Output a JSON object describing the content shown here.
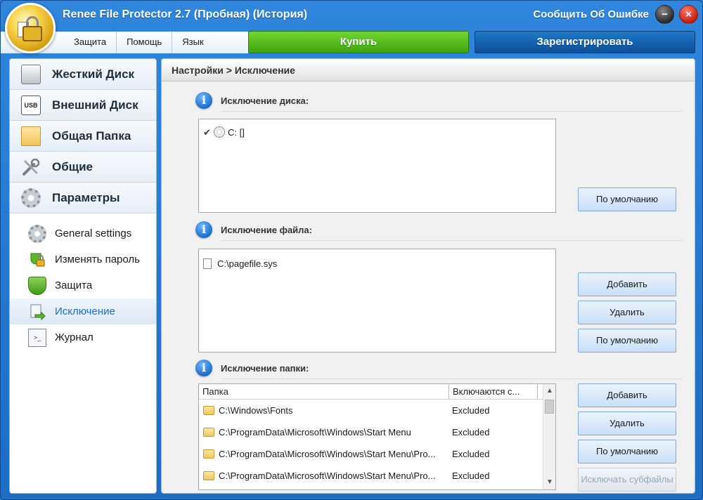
{
  "window": {
    "title": "Renee File Protector 2.7 (Пробная) (История)",
    "report_link": "Сообщить Об Ошибке",
    "minimize": "−",
    "close": "×"
  },
  "menu": {
    "items": [
      "Защита",
      "Помощь",
      "Язык"
    ],
    "buy": "Купить",
    "register": "Зарегистрировать"
  },
  "sidebar": {
    "main": [
      {
        "label": "Жесткий Диск",
        "icon": "hard-disk-icon"
      },
      {
        "label": "Внешний Диск",
        "icon": "usb-drive-icon",
        "icon_text": "USB"
      },
      {
        "label": "Общая Папка",
        "icon": "shared-folder-icon"
      },
      {
        "label": "Общие",
        "icon": "tools-icon"
      },
      {
        "label": "Параметры",
        "icon": "gear-icon"
      }
    ],
    "sub": [
      {
        "label": "General settings",
        "icon": "settings-gear-icon"
      },
      {
        "label": "Изменять пароль",
        "icon": "password-lock-icon"
      },
      {
        "label": "Защита",
        "icon": "shield-icon"
      },
      {
        "label": "Исключение",
        "icon": "exclusion-icon",
        "active": true
      },
      {
        "label": "Журнал",
        "icon": "log-icon",
        "icon_text": ">_"
      }
    ]
  },
  "content": {
    "breadcrumb": "Настройки > Исключение",
    "disk_section": {
      "title": "Исключение диска:",
      "items": [
        {
          "label": "C: []",
          "checked": true
        }
      ],
      "default_button": "По умолчанию"
    },
    "file_section": {
      "title": "Исключение файла:",
      "items": [
        "C:\\pagefile.sys"
      ],
      "add_button": "Добавить",
      "delete_button": "Удалить",
      "default_button": "По умолчанию"
    },
    "folder_section": {
      "title": "Исключение папки:",
      "columns": [
        "Папка",
        "Включаются с..."
      ],
      "rows": [
        {
          "path": "C:\\Windows\\Fonts",
          "status": "Excluded"
        },
        {
          "path": "C:\\ProgramData\\Microsoft\\Windows\\Start Menu",
          "status": "Excluded"
        },
        {
          "path": "C:\\ProgramData\\Microsoft\\Windows\\Start Menu\\Pro...",
          "status": "Excluded"
        },
        {
          "path": "C:\\ProgramData\\Microsoft\\Windows\\Start Menu\\Pro...",
          "status": "Excluded"
        }
      ],
      "add_button": "Добавить",
      "delete_button": "Удалить",
      "default_button": "По умолчанию",
      "subfolders_button": "Исключать субфайлы"
    }
  }
}
